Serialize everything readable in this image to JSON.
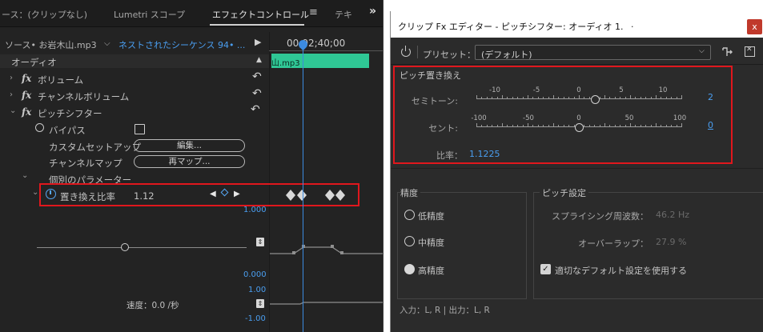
{
  "left_panel": {
    "tabs": [
      "ース：(クリップなし)",
      "Lumetri スコープ",
      "エフェクトコントロール",
      "≡",
      "テキ"
    ],
    "more_tabs_glyph": "»",
    "source_label": "ソース• お岩木山.mp3",
    "source_caret": "⌵",
    "sequence_label": "ネストされたシーケンス 94• ...",
    "play_glyph": "▶",
    "ruler_timecode": "00;02;40;00",
    "clip_name": "山.mp3",
    "audio_header": "オーディオ",
    "up_caret": "▲",
    "rows": {
      "volume": "ボリューム",
      "channel_volume": "チャンネルボリューム",
      "pitch_shifter": "ピッチシフター",
      "bypass": "バイパス",
      "custom_setup": "カスタムセットアップ",
      "edit_button": "編集...",
      "channel_map": "チャンネルマップ",
      "remap_button": "再マップ...",
      "individual_params": "個別のパラメーター",
      "transpose_ratio": "置き換え比率",
      "transpose_value": "1.12"
    },
    "fx_glyph": "fx",
    "expand_glyph": "›",
    "collapse_glyph": "⌄",
    "reset_glyph": "↶",
    "kf_prev": "◀",
    "kf_next": "▶",
    "graph_top": "1.000",
    "graph_bottom": "0.000",
    "velocity_top": "1.00",
    "velocity_label": "速度：0.0 /秒",
    "velocity_bottom": "-1.00",
    "graph_toggle_glyph": "⇕",
    "slider_value_fraction": 0.41
  },
  "dialog": {
    "title": "クリップ Fx エディター - ピッチシフター: オーディオ 1.",
    "title_dot": ".",
    "close_glyph": "x",
    "preset_label": "プリセット：",
    "preset_value": "(デフォルト)",
    "preset_caret": "⌵",
    "pitch_section_title": "ピッチ置き換え",
    "semitone_label": "セミトーン:",
    "semitone_ticks": [
      "-10",
      "-5",
      "0",
      "5",
      "10"
    ],
    "semitone_value": "2",
    "cent_label": "セント:",
    "cent_ticks": [
      "-100",
      "-50",
      "0",
      "50",
      "100"
    ],
    "cent_value": "0",
    "ratio_label": "比率：",
    "ratio_value": "1.1225",
    "precision_title": "精度",
    "precision_options": [
      "低精度",
      "中精度",
      "高精度"
    ],
    "precision_selected": 2,
    "pitch_settings_title": "ピッチ設定",
    "splicing_label": "スプライシング周波数：",
    "splicing_value": "46.2 Hz",
    "overlap_label": "オーバーラップ：",
    "overlap_value": "27.9 %",
    "default_check_label": "適切なデフォルト設定を使用する",
    "check_glyph": "✓",
    "io_label": "入力：L, R | 出力：L, R"
  },
  "colors": {
    "accent_blue": "#4a9ef0",
    "highlight_red": "#e0171d",
    "clip_green": "#2fc795",
    "close_red": "#c0392b"
  },
  "icons": [
    "power-icon",
    "stopwatch-icon",
    "reset-icon",
    "keyframe-icon",
    "close-icon",
    "routing-icon",
    "panel-close-icon"
  ]
}
